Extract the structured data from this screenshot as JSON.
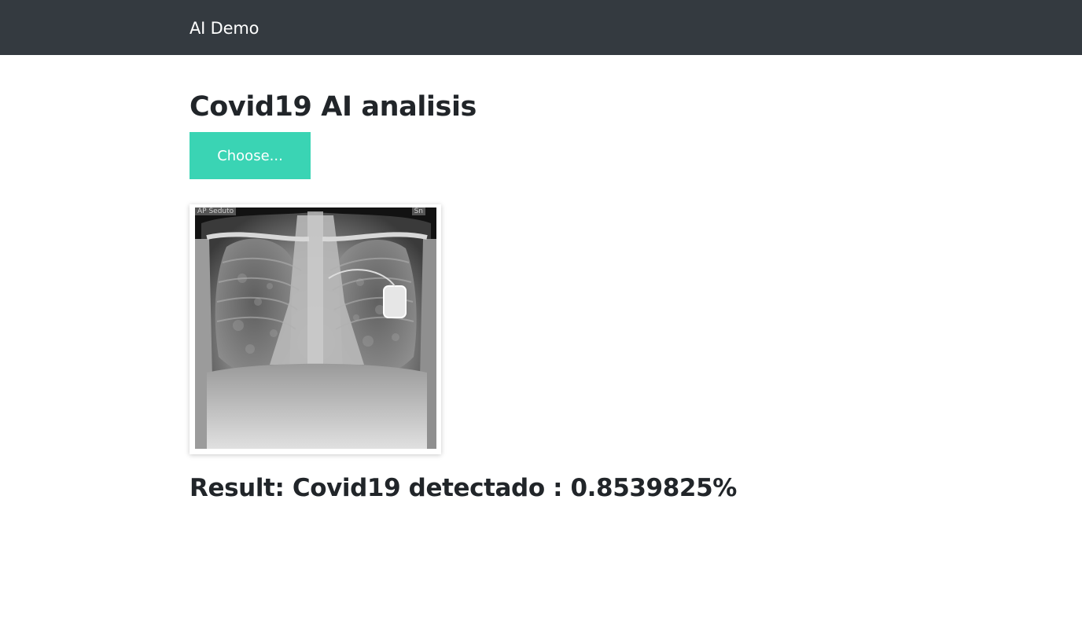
{
  "navbar": {
    "brand": "AI Demo"
  },
  "main": {
    "title": "Covid19 AI analisis",
    "choose_button": "Choose...",
    "preview": {
      "label_left": "AP Seduto",
      "label_right": "Sn"
    },
    "result_text": "Result: Covid19 detectado : 0.8539825%"
  },
  "colors": {
    "navbar_bg": "#343a40",
    "button_bg": "#3ad4b4",
    "text": "#212529"
  }
}
